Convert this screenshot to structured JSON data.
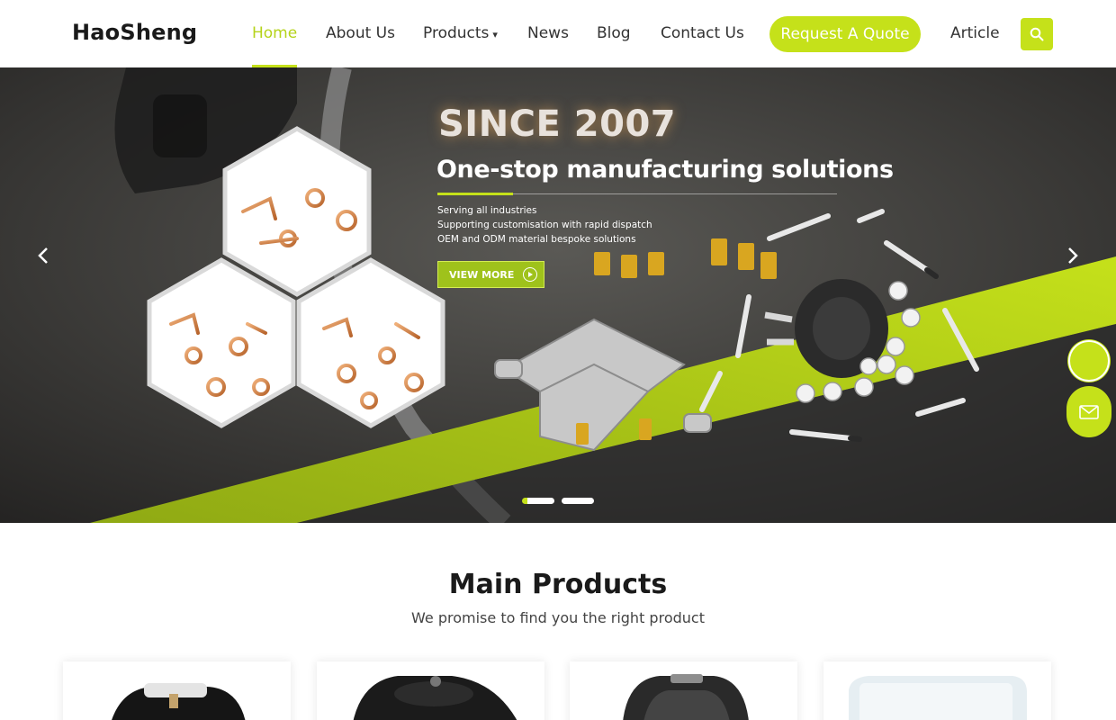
{
  "header": {
    "logo": "HaoSheng",
    "nav": {
      "home": "Home",
      "about": "About Us",
      "products": "Products",
      "news": "News",
      "blog": "Blog",
      "contact": "Contact Us",
      "quote": "Request A Quote",
      "article": "Article"
    },
    "active_item": "Home",
    "icons": [
      "chevron-down-icon",
      "search-icon"
    ]
  },
  "hero": {
    "headline": "SINCE 2007",
    "subheadline": "One-stop manufacturing solutions",
    "bullets": [
      "Serving all industries",
      "Supporting customisation with rapid dispatch",
      "OEM and ODM material bespoke solutions"
    ],
    "cta": "VIEW MORE",
    "slides_total": 2,
    "active_slide": 1
  },
  "floating": {
    "icons": [
      "chat-icon",
      "mail-icon"
    ]
  },
  "main_products": {
    "title": "Main Products",
    "subtitle": "We promise to find you the right product"
  },
  "colors": {
    "accent": "#c5e11a",
    "text_dark": "#1a1a1a",
    "hero_bg": "#2f2e2d"
  }
}
